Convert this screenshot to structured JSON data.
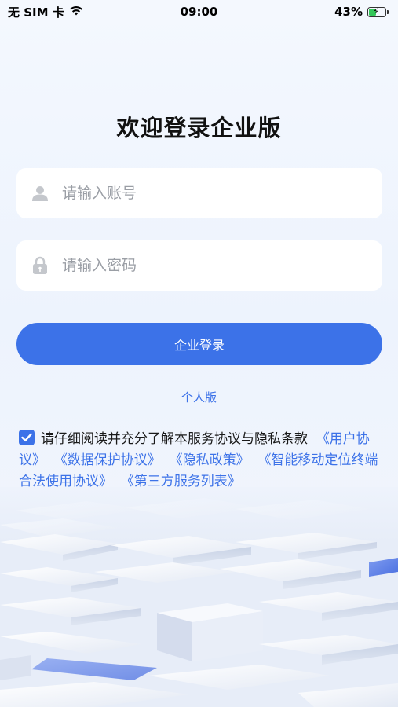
{
  "status_bar": {
    "carrier": "无 SIM 卡",
    "time": "09:00",
    "battery": "43%",
    "battery_level": 0.43
  },
  "page": {
    "title": "欢迎登录企业版"
  },
  "login_form": {
    "account_placeholder": "请输入账号",
    "account_value": "",
    "password_placeholder": "请输入密码",
    "password_value": "",
    "login_button": "企业登录",
    "personal_link": "个人版"
  },
  "agreement": {
    "checked": true,
    "prefix": "请仔细阅读并充分了解本服务协议与隐私条款",
    "links": [
      "《用户协议》",
      "《数据保护协议》",
      "《隐私政策》",
      "《智能移动定位终端合法使用协议》",
      "《第三方服务列表》"
    ]
  },
  "icons": {
    "account": "user-icon",
    "password": "lock-icon",
    "wifi": "wifi-icon",
    "battery": "battery-charging-icon",
    "checkbox": "checkbox-checked-icon"
  },
  "colors": {
    "accent": "#3c72e8",
    "battery_fill": "#34c759"
  }
}
